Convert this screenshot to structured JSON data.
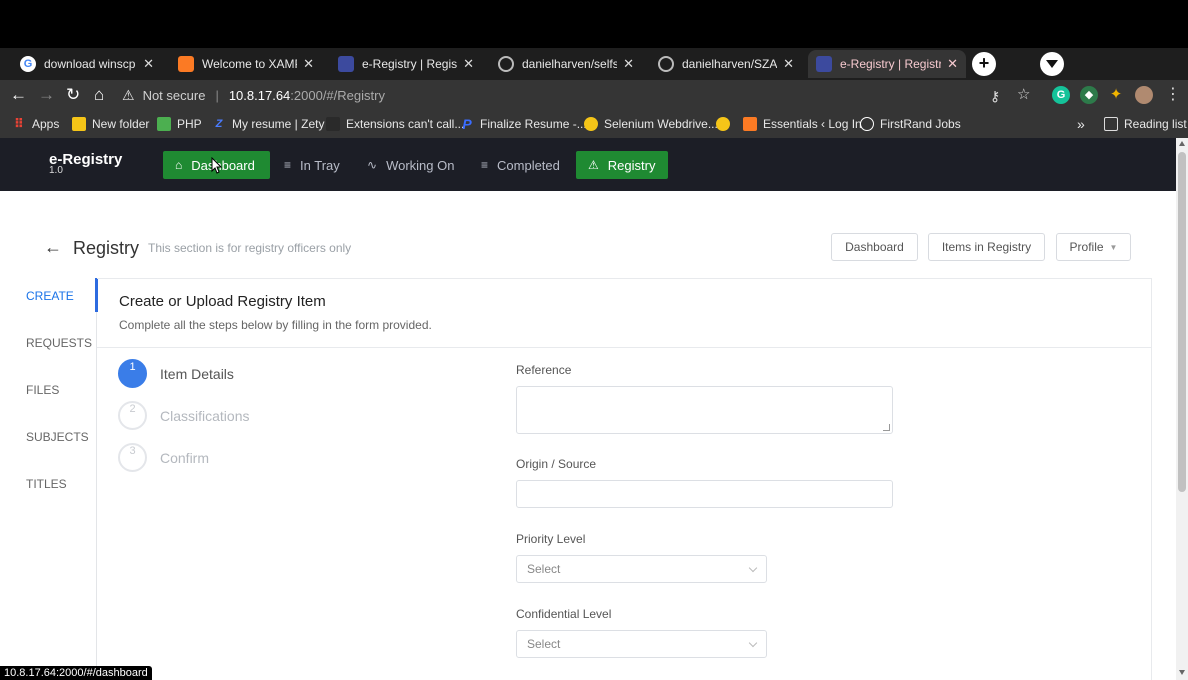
{
  "browser": {
    "tabs": [
      {
        "title": "download winscp - G",
        "favicon_color": "#4285f4",
        "active": false
      },
      {
        "title": "Welcome to XAMPP",
        "favicon_color": "#fb7a24",
        "active": false
      },
      {
        "title": "e-Registry | Registry",
        "favicon_color": "#7b8cff",
        "active": false
      },
      {
        "title": "danielharven/selfservic",
        "favicon_color": "#ffffff",
        "active": false
      },
      {
        "title": "danielharven/SZAR-ui",
        "favicon_color": "#ffffff",
        "active": false
      },
      {
        "title": "e-Registry | Registry",
        "favicon_color": "#7b8cff",
        "active": true
      }
    ],
    "new_tab_icon": "+",
    "address": {
      "security": "Not secure",
      "host": "10.8.17.64",
      "path": ":2000/#/Registry"
    },
    "bookmarks": [
      {
        "label": "Apps",
        "icon": "apps-grid-icon",
        "color": "#e94235"
      },
      {
        "label": "New folder",
        "icon": "folder-icon",
        "color": "#f5c518"
      },
      {
        "label": "PHP",
        "icon": "php-icon",
        "color": "#4caf50"
      },
      {
        "label": "My resume | Zety",
        "icon": "zety-icon",
        "color": "#4a7cff"
      },
      {
        "label": "Extensions can't call...",
        "icon": "doc-icon",
        "color": "#333333"
      },
      {
        "label": "Finalize Resume -...",
        "icon": "p-icon",
        "color": "#3a6cff"
      },
      {
        "label": "Selenium Webdrive...",
        "icon": "selenium-icon",
        "color": "#f5c518"
      },
      {
        "label": "Essentials ‹ Log In",
        "icon": "xampp-icon",
        "color": "#fb7a24"
      },
      {
        "label": "FirstRand Jobs",
        "icon": "firstrand-icon",
        "color": "#ffffff"
      }
    ],
    "bookmarks_overflow": "»",
    "reading_list": "Reading list",
    "status_url": "10.8.17.64:2000/#/dashboard"
  },
  "app": {
    "brand": "e-Registry",
    "version": "1.0",
    "nav": [
      {
        "label": "Dashboard",
        "icon": "home-icon",
        "style": "green"
      },
      {
        "label": "In Tray",
        "icon": "list-icon",
        "style": "plain"
      },
      {
        "label": "Working On",
        "icon": "activity-icon",
        "style": "plain"
      },
      {
        "label": "Completed",
        "icon": "list-icon",
        "style": "plain"
      },
      {
        "label": "Registry",
        "icon": "warning-icon",
        "style": "green"
      }
    ]
  },
  "page": {
    "title": "Registry",
    "subtitle": "This section is for registry officers only",
    "actions": [
      "Dashboard",
      "Items in Registry",
      "Profile"
    ],
    "sidebar": [
      "CREATE",
      "REQUESTS",
      "FILES",
      "SUBJECTS",
      "TITLES"
    ],
    "card": {
      "title": "Create or Upload Registry Item",
      "description": "Complete all the steps below by filling in the form provided."
    },
    "steps": [
      {
        "number": "1",
        "label": "Item Details",
        "active": true
      },
      {
        "number": "2",
        "label": "Classifications",
        "active": false
      },
      {
        "number": "3",
        "label": "Confirm",
        "active": false
      }
    ],
    "form": {
      "reference_label": "Reference",
      "reference_value": "",
      "origin_label": "Origin / Source",
      "origin_value": "",
      "priority_label": "Priority Level",
      "priority_value": "Select",
      "confidential_label": "Confidential Level",
      "confidential_value": "Select"
    }
  },
  "colors": {
    "nav_green": "#1f8a32",
    "accent_blue": "#3a7de8",
    "header_bg": "#1c1e26"
  }
}
